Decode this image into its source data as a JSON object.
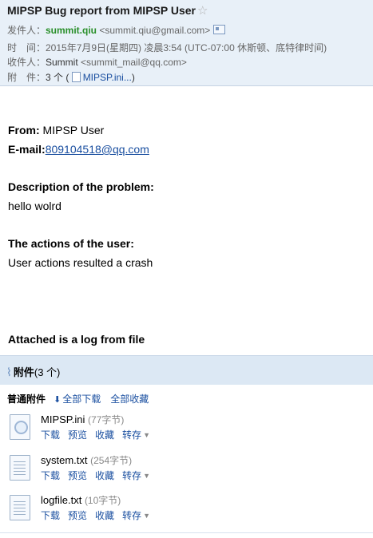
{
  "header": {
    "subject": "MIPSP Bug report from MIPSP User",
    "from_label": "发件人：",
    "from_name": "summit.qiu",
    "from_email": "<summit.qiu@gmail.com>",
    "time_label": "时　间：",
    "time_value": "2015年7月9日(星期四) 凌晨3:54 (UTC-07:00 休斯顿、底特律时间)",
    "to_label": "收件人：",
    "to_name": "Summit",
    "to_email": "<summit_mail@qq.com>",
    "attach_label": "附　件：",
    "attach_count": "3 个 (",
    "attach_preview": "MIPSP.ini...",
    "attach_close": ")"
  },
  "body": {
    "from_label": "From:",
    "from_value": " MIPSP User",
    "email_label": "E-mail:",
    "email_value": "809104518@qq.com",
    "desc_label": "Description of the problem:",
    "desc_value": "hello wolrd",
    "actions_label": "The actions of the user:",
    "actions_value": "User actions resulted a crash",
    "attached_text": "Attached is a log from file"
  },
  "attachments": {
    "bar_title": "附件",
    "bar_count": "(3 个)",
    "section_title": "普通附件",
    "download_all": "全部下载",
    "save_all": "全部收藏",
    "files": [
      {
        "name": "MIPSP.ini",
        "size": "(77字节)"
      },
      {
        "name": "system.txt",
        "size": "(254字节)"
      },
      {
        "name": "logfile.txt",
        "size": "(10字节)"
      }
    ],
    "actions": {
      "download": "下载",
      "preview": "预览",
      "favorite": "收藏",
      "forward": "转存"
    }
  }
}
